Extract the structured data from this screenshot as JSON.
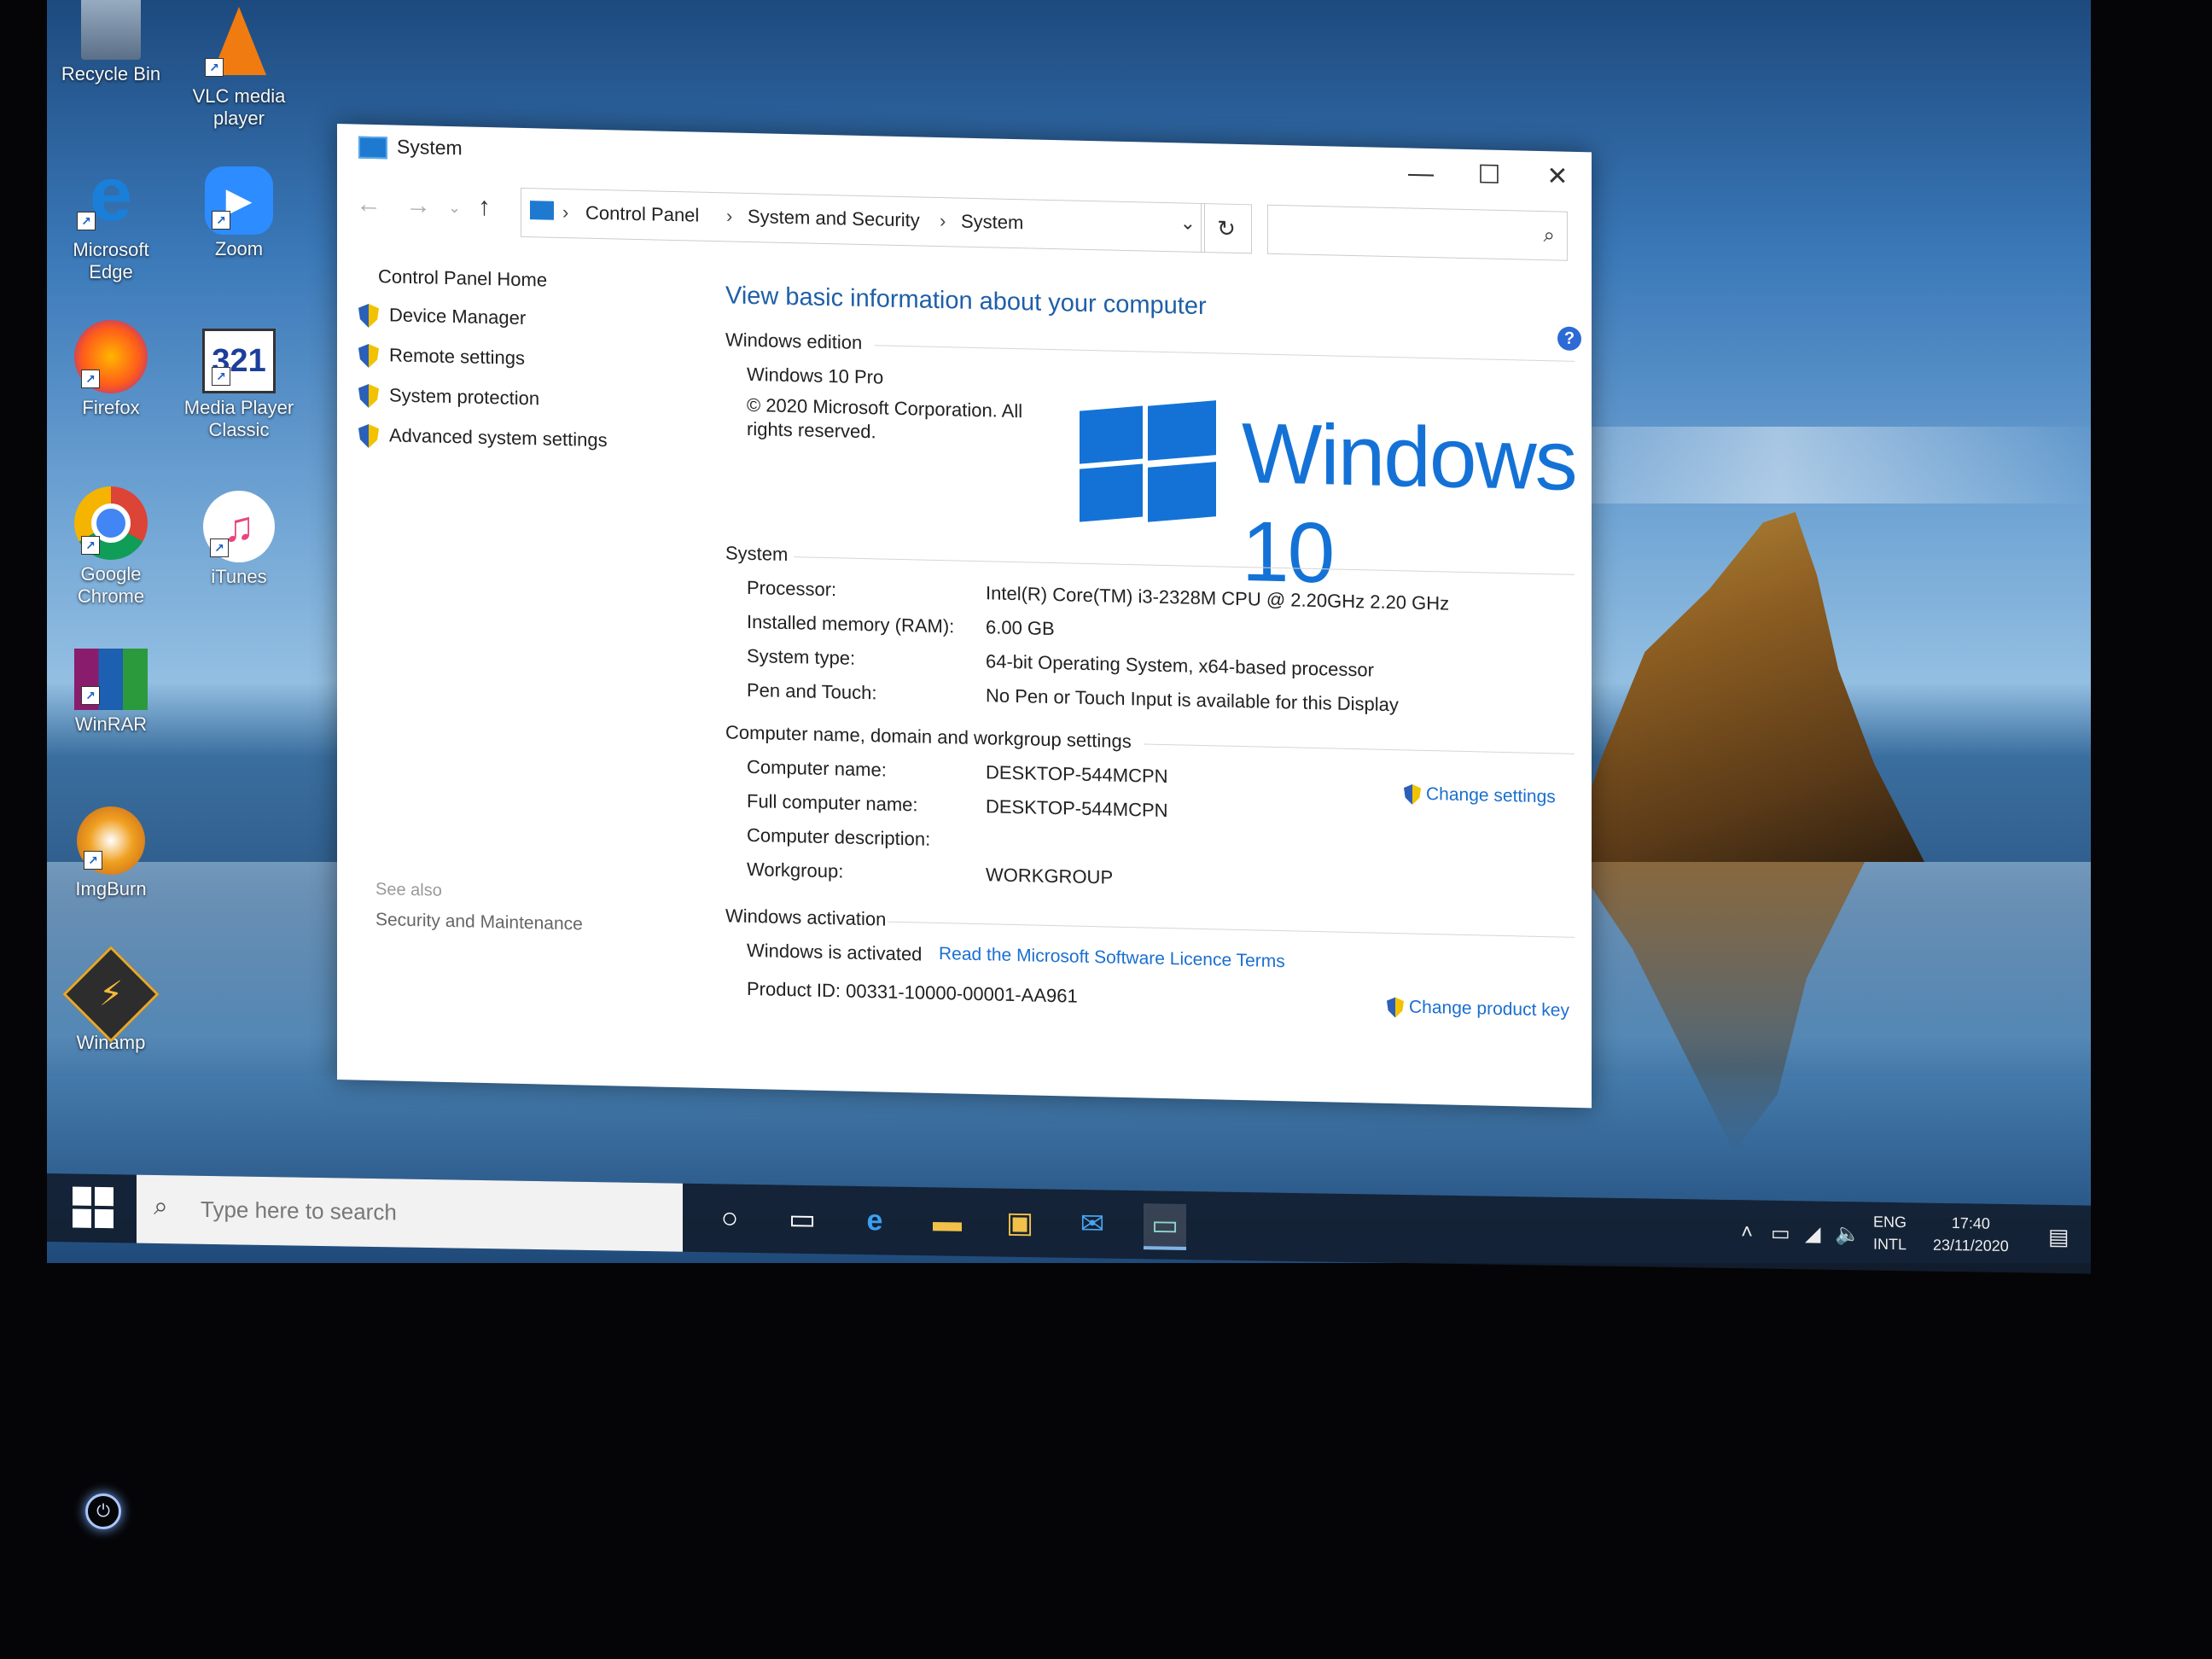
{
  "desktop": {
    "icons": [
      {
        "label": "Recycle Bin"
      },
      {
        "label": "VLC media player"
      },
      {
        "label": "Microsoft Edge"
      },
      {
        "label": "Zoom"
      },
      {
        "label": "Firefox"
      },
      {
        "label": "Media Player Classic"
      },
      {
        "label": "Google Chrome"
      },
      {
        "label": "iTunes"
      },
      {
        "label": "WinRAR"
      },
      {
        "label": "ImgBurn"
      },
      {
        "label": "Winamp"
      }
    ]
  },
  "window": {
    "title": "System",
    "controls": {
      "minimize": "—",
      "maximize": "☐",
      "close": "✕"
    },
    "address": {
      "crumbs": [
        "Control Panel",
        "System and Security",
        "System"
      ],
      "separator": "›"
    },
    "search_placeholder": ""
  },
  "leftpane": {
    "home": "Control Panel Home",
    "tasks": [
      "Device Manager",
      "Remote settings",
      "System protection",
      "Advanced system settings"
    ],
    "see_also": "See also",
    "security_link": "Security and Maintenance"
  },
  "main": {
    "heading": "View basic information about your computer",
    "edition": {
      "section": "Windows edition",
      "name": "Windows 10 Pro",
      "copyright": "© 2020 Microsoft Corporation. All rights reserved.",
      "logo_text": "Windows 10"
    },
    "system": {
      "section": "System",
      "rows": [
        {
          "label": "Processor:",
          "value": "Intel(R) Core(TM) i3-2328M CPU @ 2.20GHz   2.20 GHz"
        },
        {
          "label": "Installed memory (RAM):",
          "value": "6.00 GB"
        },
        {
          "label": "System type:",
          "value": "64-bit Operating System, x64-based processor"
        },
        {
          "label": "Pen and Touch:",
          "value": "No Pen or Touch Input is available for this Display"
        }
      ]
    },
    "computer": {
      "section": "Computer name, domain and workgroup settings",
      "rows": [
        {
          "label": "Computer name:",
          "value": "DESKTOP-544MCPN"
        },
        {
          "label": "Full computer name:",
          "value": "DESKTOP-544MCPN"
        },
        {
          "label": "Computer description:",
          "value": ""
        },
        {
          "label": "Workgroup:",
          "value": "WORKGROUP"
        }
      ],
      "change_link": "Change settings"
    },
    "activation": {
      "section": "Windows activation",
      "status": "Windows is activated",
      "licence_link": "Read the Microsoft Software Licence Terms",
      "product_id": "Product ID:  00331-10000-00001-AA961",
      "change_key_link": "Change product key"
    }
  },
  "taskbar": {
    "search_placeholder": "Type here to search",
    "lang": [
      "ENG",
      "INTL"
    ],
    "time": "17:40",
    "date": "23/11/2020"
  },
  "colors": {
    "accent": "#1e5fa8",
    "link": "#1a6fd0",
    "windows_blue": "#1472d6"
  }
}
